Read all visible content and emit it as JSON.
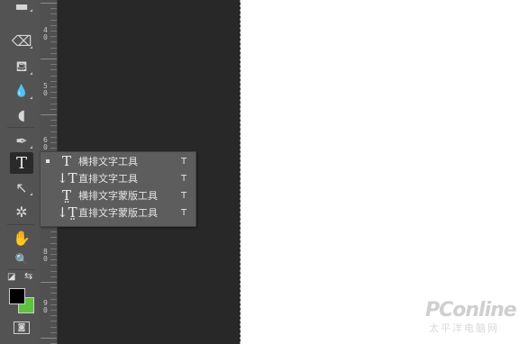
{
  "toolbar": {
    "tools": [
      {
        "name": "eraser-tool",
        "icon": "eraser-icon",
        "glyph": "⌫"
      },
      {
        "name": "paint-bucket-tool",
        "icon": "paint-bucket-icon",
        "glyph": "⛾"
      },
      {
        "name": "blur-tool",
        "icon": "water-drop-icon",
        "glyph": "💧"
      },
      {
        "name": "dodge-tool",
        "icon": "dodge-icon",
        "glyph": "◖"
      },
      {
        "name": "pen-tool",
        "icon": "pen-icon",
        "glyph": "✒"
      },
      {
        "name": "type-tool",
        "icon": "type-icon",
        "glyph": "T"
      },
      {
        "name": "path-selection-tool",
        "icon": "arrow-cursor-icon",
        "glyph": "↖"
      },
      {
        "name": "custom-shape-tool",
        "icon": "shape-icon",
        "glyph": "✲"
      },
      {
        "name": "hand-tool",
        "icon": "hand-icon",
        "glyph": "✋"
      },
      {
        "name": "zoom-tool",
        "icon": "magnifier-icon",
        "glyph": "🔍"
      }
    ],
    "swap_glyph": "⇆",
    "default_colors_glyph": "◪",
    "quick_mask_glyph": "◙",
    "foreground_color": "#000000",
    "background_color": "#5ec23c"
  },
  "ruler": {
    "labels": [
      {
        "digit": "4",
        "sub": "0"
      },
      {
        "digit": "5",
        "sub": "0"
      },
      {
        "digit": "6",
        "sub": "0"
      },
      {
        "digit": "8",
        "sub": "0"
      },
      {
        "digit": "9",
        "sub": "0"
      }
    ]
  },
  "type_flyout": {
    "items": [
      {
        "icon": "T",
        "label": "横排文字工具",
        "shortcut": "T",
        "selected": true
      },
      {
        "icon": "↓T",
        "label": "直排文字工具",
        "shortcut": "T",
        "selected": false
      },
      {
        "icon": "T̤",
        "label": "横排文字蒙版工具",
        "shortcut": "T",
        "selected": false
      },
      {
        "icon": "↓T̤",
        "label": "直排文字蒙版工具",
        "shortcut": "T",
        "selected": false
      }
    ]
  },
  "watermark": {
    "text": "PConline",
    "subtext": "太平洋电脑网"
  }
}
